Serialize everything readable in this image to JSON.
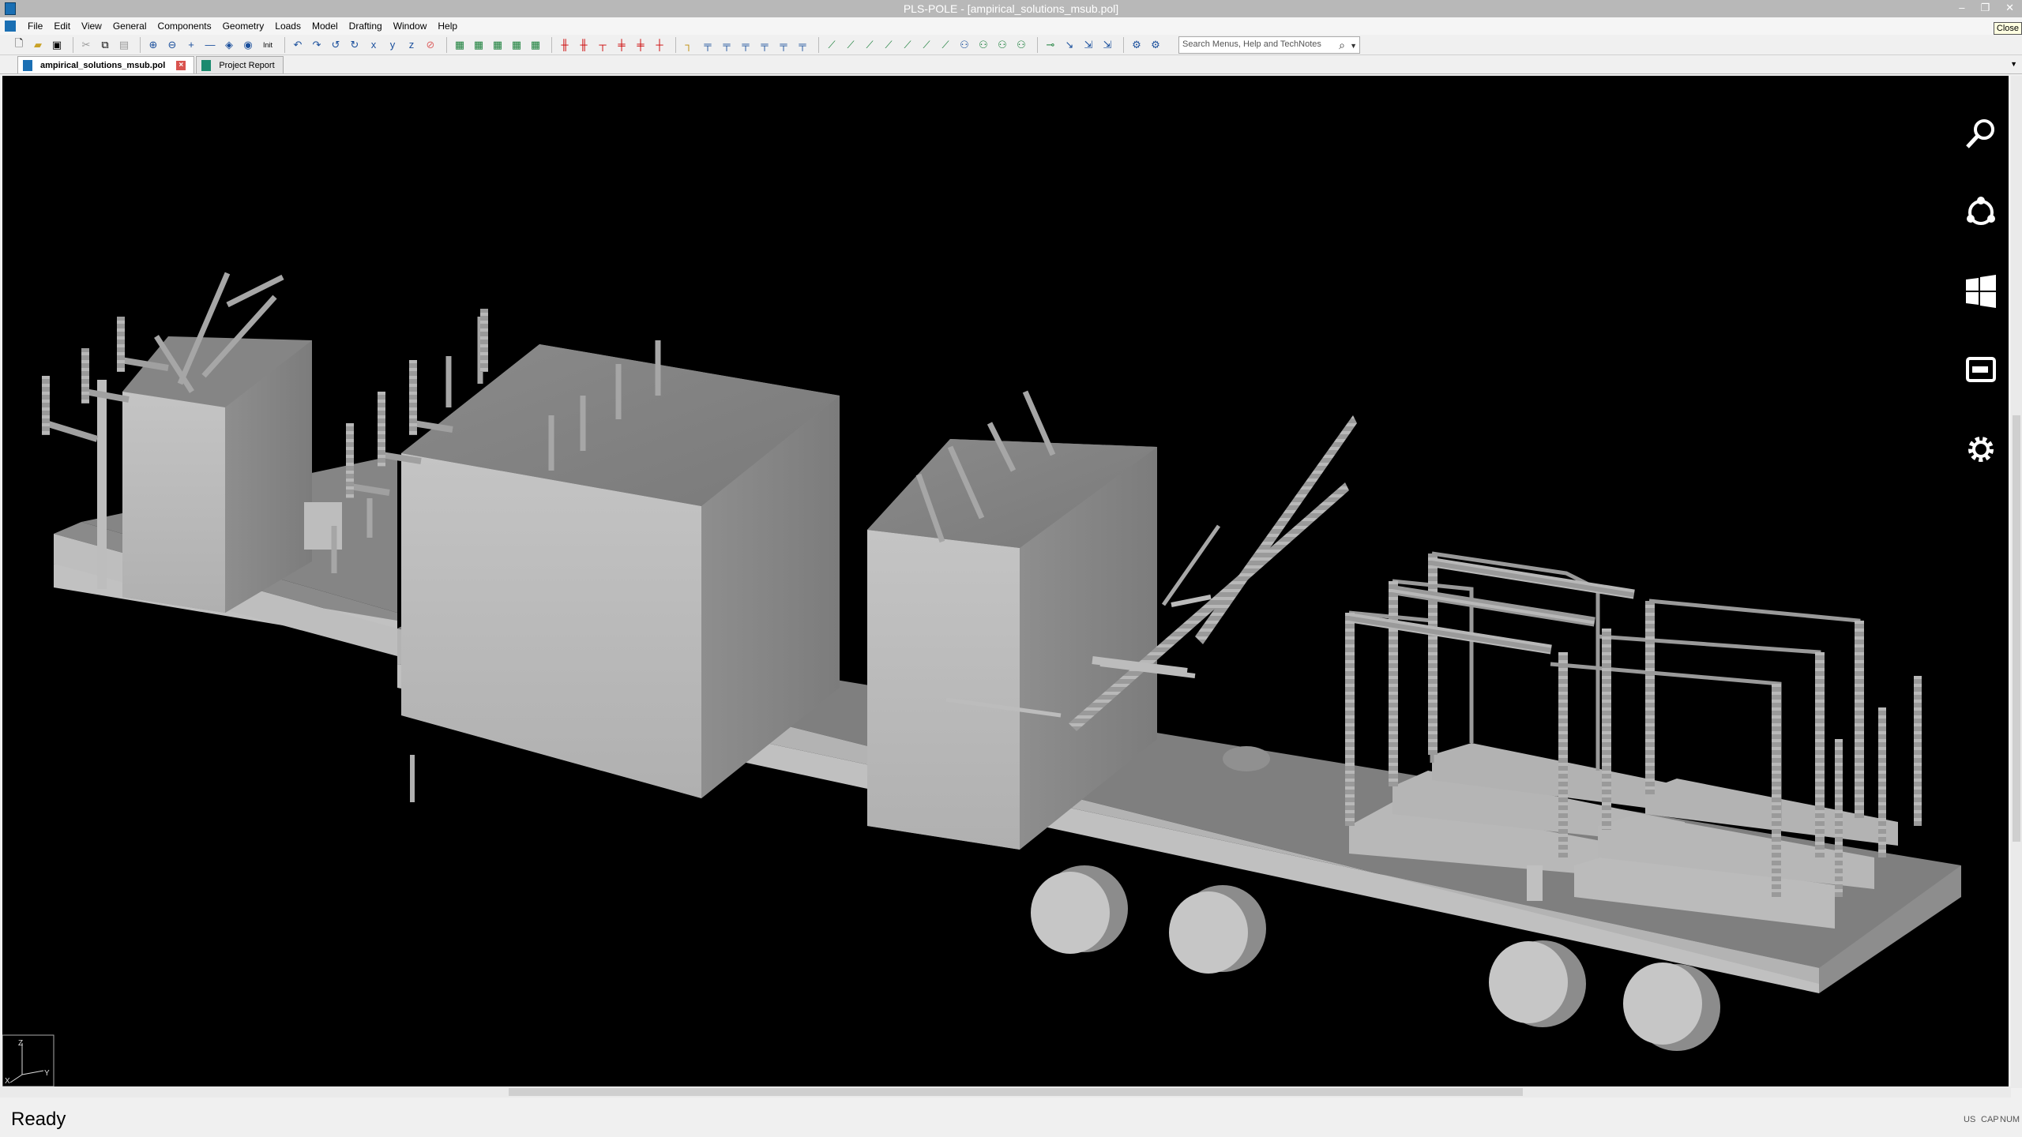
{
  "window": {
    "title": "PLS-POLE - [ampirical_solutions_msub.pol]"
  },
  "menu": [
    "File",
    "Edit",
    "View",
    "General",
    "Components",
    "Geometry",
    "Loads",
    "Model",
    "Drafting",
    "Window",
    "Help"
  ],
  "mdi": {
    "close_tooltip": "Close"
  },
  "toolbar": {
    "init_label": "Init",
    "search_placeholder": "Search Menus, Help and TechNotes"
  },
  "tabs": [
    {
      "label": "ampirical_solutions_msub.pol",
      "active": true
    },
    {
      "label": "Project Report",
      "active": false
    }
  ],
  "axes": {
    "x": "X",
    "y": "Y",
    "z": "Z"
  },
  "status": {
    "text": "Ready",
    "indicators": [
      "US",
      "CAP",
      "NUM"
    ]
  },
  "icons": [
    "search-charm-icon",
    "share-charm-icon",
    "start-charm-icon",
    "devices-charm-icon",
    "settings-charm-icon"
  ],
  "colors": {
    "viewport_bg": "#000000",
    "model_gray": "#a6a6a6"
  }
}
